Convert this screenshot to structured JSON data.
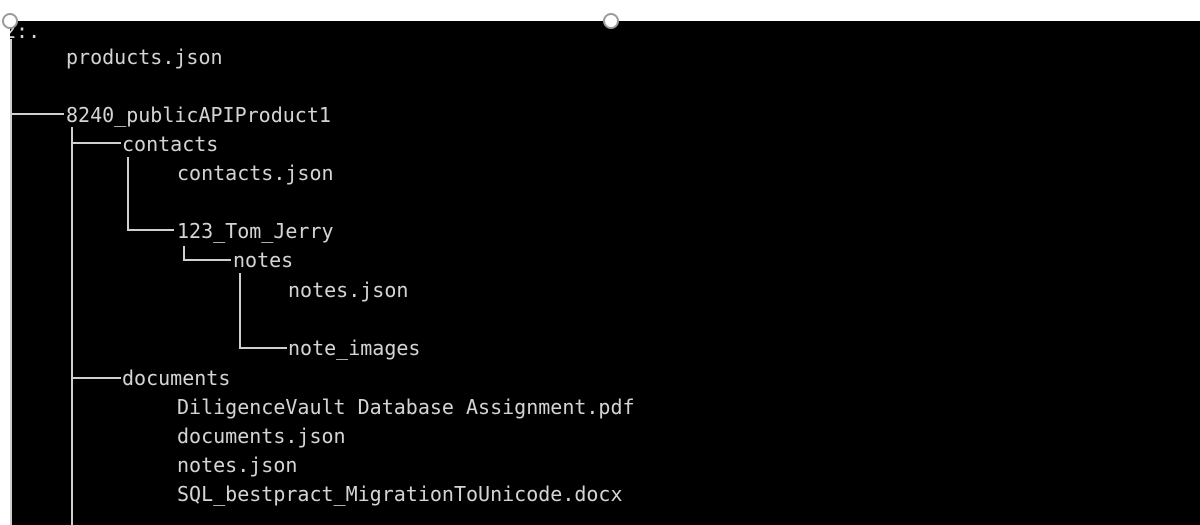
{
  "console": {
    "root_label": "2:.",
    "lines": [
      "products.json",
      "8240_publicAPIProduct1",
      "contacts",
      "contacts.json",
      "123_Tom_Jerry",
      "notes",
      "notes.json",
      "note_images",
      "documents",
      "DiligenceVault Database Assignment.pdf",
      "documents.json",
      "notes.json",
      "SQL_bestpract_MigrationToUnicode.docx"
    ]
  },
  "colors": {
    "background": "#000000",
    "text": "#d4d4d4",
    "tree_lines": "#cfcfcf",
    "page": "#ffffff"
  }
}
